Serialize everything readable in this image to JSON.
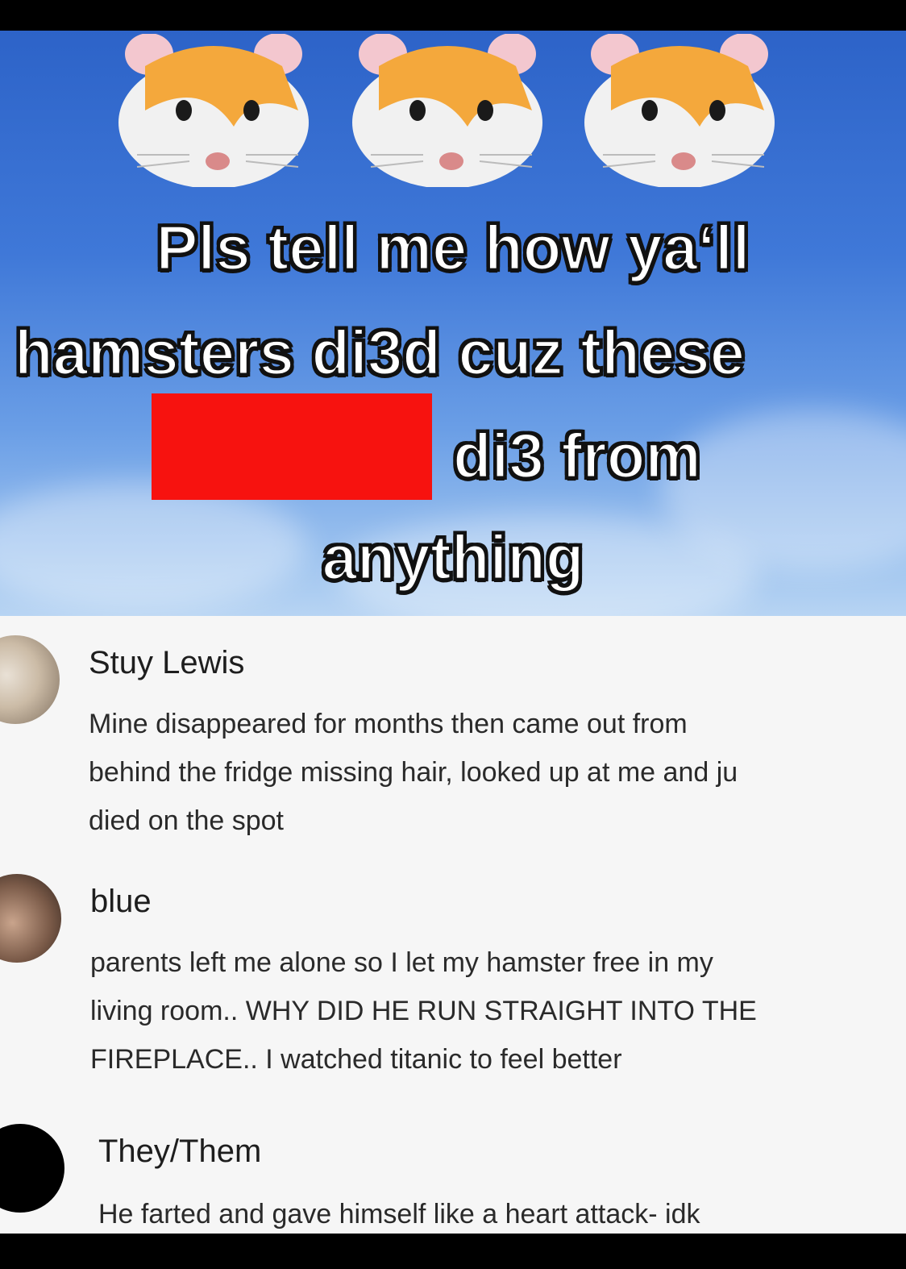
{
  "post": {
    "caption": {
      "line1": "Pls tell me how ya‘ll",
      "line2": "hamsters di3d cuz these",
      "line3": "di3 from",
      "line4": "anything"
    },
    "hamster_icon": "hamster-face-emoji",
    "redaction_color": "#f7120f"
  },
  "comments": [
    {
      "author": "Stuy Lewis",
      "lines": [
        "Mine disappeared for months then came out from",
        "behind the fridge missing hair, looked up at me and ju",
        "died on the spot"
      ]
    },
    {
      "author": "blue",
      "lines": [
        "parents left me alone so I let my hamster free in my",
        "living room.. WHY DID HE RUN STRAIGHT INTO THE",
        "FIREPLACE.. I watched titanic to feel better"
      ]
    },
    {
      "author": "They/Them",
      "lines": [
        "He farted and gave himself like a heart attack- idk"
      ]
    }
  ]
}
